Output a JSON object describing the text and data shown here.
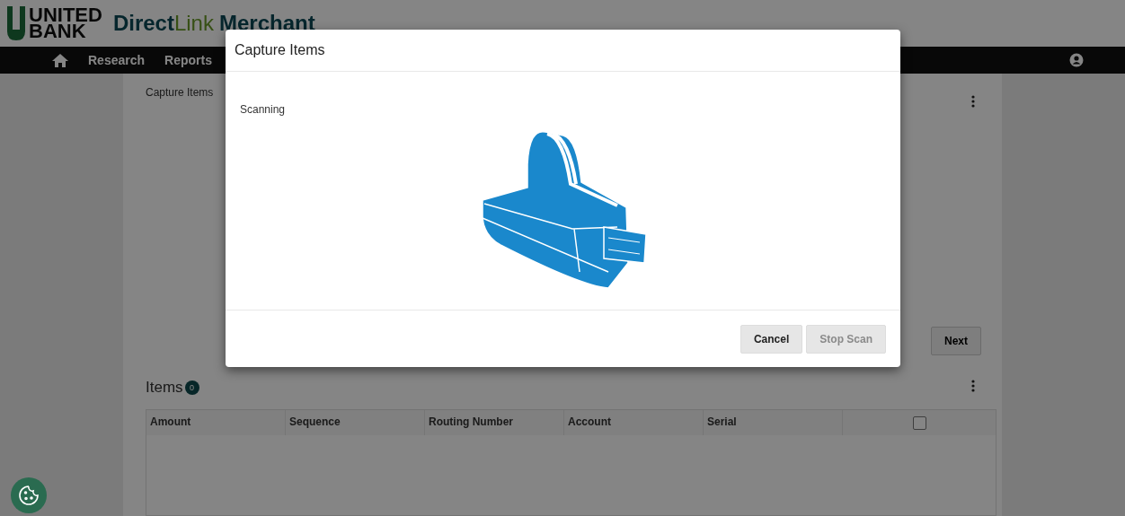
{
  "header": {
    "logo_line1": "UNITED",
    "logo_line2": "BANK",
    "brand_part1": "Direct",
    "brand_part2": "Link",
    "brand_part3": "Merchant"
  },
  "nav": {
    "items": [
      "Research",
      "Reports"
    ]
  },
  "page": {
    "breadcrumb": "Capture Items",
    "next_button": "Next",
    "items_title": "Items",
    "items_count": "0",
    "columns": [
      "Amount",
      "Sequence",
      "Routing Number",
      "Account",
      "Serial"
    ],
    "select_all_checked": false
  },
  "modal": {
    "title": "Capture Items",
    "status": "Scanning",
    "buttons": [
      {
        "label": "Cancel",
        "disabled": false
      },
      {
        "label": "Stop Scan",
        "disabled": true
      }
    ]
  }
}
